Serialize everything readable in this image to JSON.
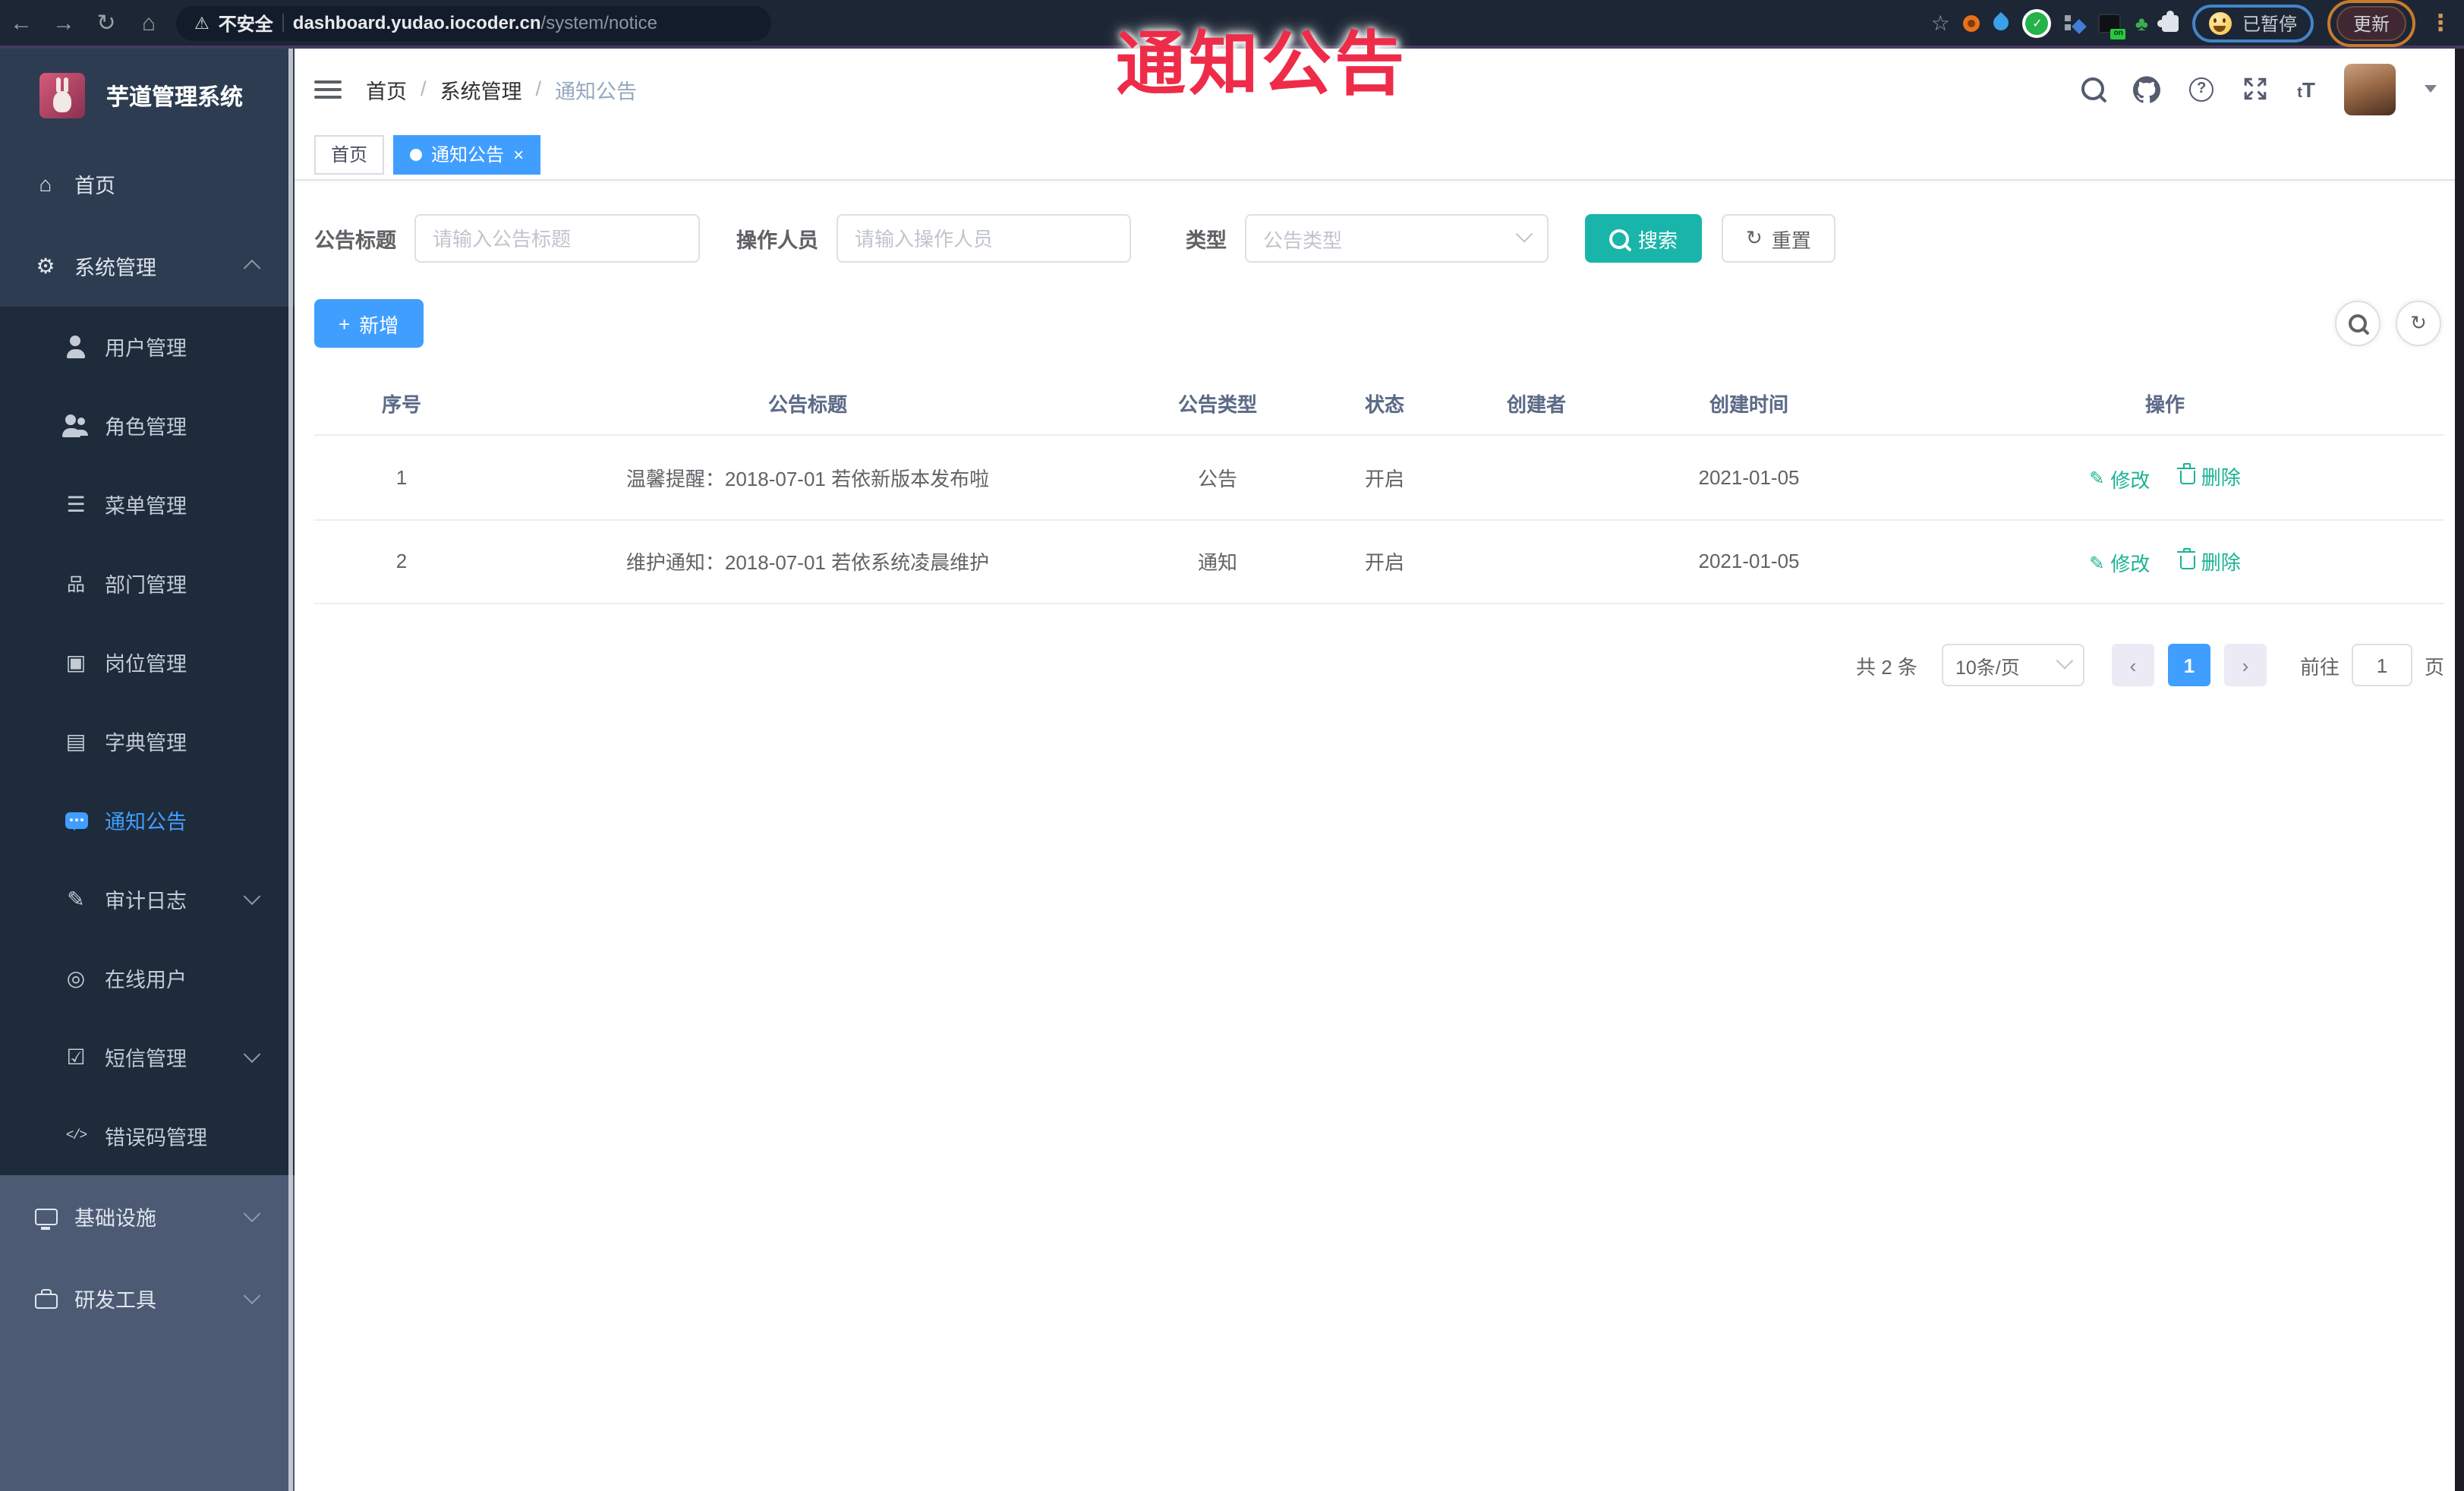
{
  "colors": {
    "accent_blue": "#409eff",
    "search_teal": "#1ab5aa",
    "action_green": "#1ab394",
    "overlay_red": "#ee2c49",
    "sidebar_dark": "#1e2b3a"
  },
  "overlay": {
    "title": "通知公告"
  },
  "browser": {
    "security_label": "不安全",
    "url_host": "dashboard.yudao.iocoder.cn",
    "url_path": "/system/notice",
    "profile_label": "已暂停",
    "update_label": "更新",
    "extension_badge": "on"
  },
  "icons": {
    "back": "←",
    "forward": "→",
    "reload": "↻",
    "home": "⌂",
    "warning": "⚠",
    "star": "☆",
    "menu_dots": "⋮",
    "check": "✓",
    "sprout": "♣",
    "question": "?",
    "font_small": "t",
    "font_big": "T",
    "plus": "+",
    "refresh": "↻",
    "pencil": "✎",
    "prev": "‹",
    "next": "›",
    "tab_close": "×"
  },
  "sidebar": {
    "title": "芋道管理系统",
    "items": [
      {
        "label": "首页",
        "icon": "dashboard-icon",
        "glyph": "⌂"
      },
      {
        "label": "系统管理",
        "icon": "gear-icon",
        "glyph": "⚙",
        "expanded": true
      },
      {
        "label": "用户管理",
        "icon": "user-icon"
      },
      {
        "label": "角色管理",
        "icon": "users-icon"
      },
      {
        "label": "菜单管理",
        "icon": "menu-list-icon",
        "glyph": "☰"
      },
      {
        "label": "部门管理",
        "icon": "org-tree-icon",
        "glyph": "品"
      },
      {
        "label": "岗位管理",
        "icon": "post-badge-icon",
        "glyph": "▣"
      },
      {
        "label": "字典管理",
        "icon": "dict-book-icon",
        "glyph": "▤"
      },
      {
        "label": "通知公告",
        "icon": "notice-bubble-icon",
        "active": true
      },
      {
        "label": "审计日志",
        "icon": "audit-log-icon",
        "glyph": "✎",
        "arrow": "down"
      },
      {
        "label": "在线用户",
        "icon": "online-users-icon",
        "glyph": "◎"
      },
      {
        "label": "短信管理",
        "icon": "sms-shield-icon",
        "glyph": "☑",
        "arrow": "down"
      },
      {
        "label": "错误码管理",
        "icon": "error-code-icon",
        "glyph": "</>"
      },
      {
        "label": "基础设施",
        "icon": "infrastructure-icon",
        "arrow": "down"
      },
      {
        "label": "研发工具",
        "icon": "dev-tools-icon",
        "arrow": "down"
      }
    ]
  },
  "header": {
    "breadcrumb": [
      "首页",
      "系统管理",
      "通知公告"
    ],
    "separator": "/"
  },
  "tabs": [
    {
      "label": "首页",
      "active": false
    },
    {
      "label": "通知公告",
      "active": true,
      "closable": true
    }
  ],
  "filters": {
    "title_label": "公告标题",
    "title_placeholder": "请输入公告标题",
    "operator_label": "操作人员",
    "operator_placeholder": "请输入操作人员",
    "type_label": "类型",
    "type_placeholder": "公告类型",
    "search_label": "搜索",
    "reset_label": "重置"
  },
  "toolbar": {
    "add_label": "新增"
  },
  "table": {
    "columns": [
      "序号",
      "公告标题",
      "公告类型",
      "状态",
      "创建者",
      "创建时间",
      "操作"
    ],
    "rows": [
      {
        "index": "1",
        "title": "温馨提醒：2018-07-01 若依新版本发布啦",
        "type": "公告",
        "status": "开启",
        "creator": "",
        "created": "2021-01-05",
        "edit": "修改",
        "delete": "删除"
      },
      {
        "index": "2",
        "title": "维护通知：2018-07-01 若依系统凌晨维护",
        "type": "通知",
        "status": "开启",
        "creator": "",
        "created": "2021-01-05",
        "edit": "修改",
        "delete": "删除"
      }
    ]
  },
  "pagination": {
    "total": "共 2 条",
    "page_size": "10条/页",
    "current": "1",
    "goto_label": "前往",
    "goto_value": "1",
    "page_label": "页"
  }
}
